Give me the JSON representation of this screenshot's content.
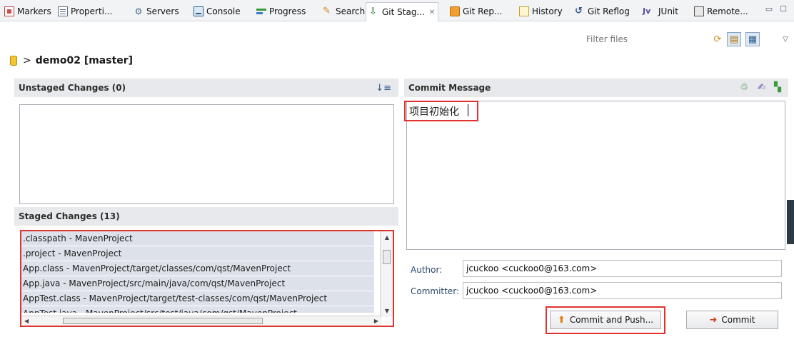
{
  "tabs": [
    {
      "label": "Markers",
      "icon": "markers-icon"
    },
    {
      "label": "Properti...",
      "icon": "properties-icon"
    },
    {
      "label": "Servers",
      "icon": "servers-icon"
    },
    {
      "label": "Console",
      "icon": "console-icon"
    },
    {
      "label": "Progress",
      "icon": "progress-icon"
    },
    {
      "label": "Search",
      "icon": "search-icon"
    },
    {
      "label": "Git Stag...",
      "icon": "git-staging-icon",
      "active": true
    },
    {
      "label": "Git Rep...",
      "icon": "git-repositories-icon"
    },
    {
      "label": "History",
      "icon": "history-icon"
    },
    {
      "label": "Git Reflog",
      "icon": "git-reflog-icon"
    },
    {
      "label": "JUnit",
      "icon": "junit-icon",
      "icon_text": "Jv"
    },
    {
      "label": "Remote...",
      "icon": "remote-icon"
    }
  ],
  "toolbar": {
    "filter_placeholder": "Filter files"
  },
  "repo": {
    "separator": ">",
    "name": "demo02 [master]"
  },
  "unstaged": {
    "title": "Unstaged Changes (0)",
    "items": []
  },
  "staged": {
    "title": "Staged Changes (13)",
    "items": [
      ".classpath - MavenProject",
      ".project - MavenProject",
      "App.class - MavenProject/target/classes/com/qst/MavenProject",
      "App.java - MavenProject/src/main/java/com/qst/MavenProject",
      "AppTest.class - MavenProject/target/test-classes/com/qst/MavenProject",
      "AppTest.java - MavenProject/src/test/java/com/qst/MavenProject"
    ]
  },
  "commit": {
    "title": "Commit Message",
    "message": "项目初始化",
    "author_label": "Author:",
    "author": "jcuckoo <cuckoo0@163.com>",
    "committer_label": "Committer:",
    "committer": "jcuckoo <cuckoo0@163.com>",
    "commit_push_label": "Commit and Push...",
    "commit_label": "Commit"
  },
  "colors": {
    "highlight": "#e0322e",
    "section_header": "#e8e9ec",
    "row_bg": "#dde2ea"
  }
}
